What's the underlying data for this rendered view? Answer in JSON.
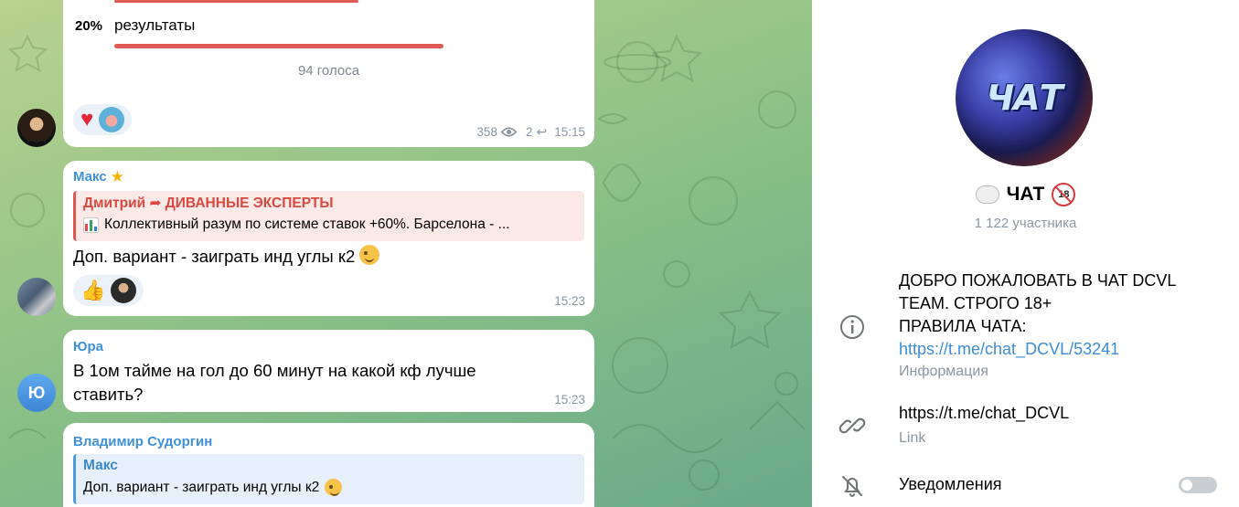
{
  "chat": {
    "poll": {
      "option_percent": "20%",
      "option_label": "результаты",
      "votes": "94 голоса",
      "views": "358",
      "replies": "2",
      "time": "15:15"
    },
    "messages": [
      {
        "sender": "Макс",
        "quote_title": "Дмитрий ➦ ДИВАННЫЕ ЭКСПЕРТЫ",
        "quote_text": "Коллективный разум по системе ставок +60%. Барселона - ...",
        "text": "Доп. вариант - заиграть инд углы к2",
        "time": "15:23"
      },
      {
        "sender": "Юра",
        "avatar_letter": "Ю",
        "text": "В 1ом тайме на гол до 60 минут на какой кф лучше ставить?",
        "time": "15:23"
      },
      {
        "sender": "Владимир Судоргин",
        "quote_title": "Макс",
        "quote_text": "Доп. вариант - заиграть инд углы к2"
      }
    ]
  },
  "info": {
    "avatar_text": "ЧАТ",
    "name": "ЧАТ",
    "members": "1 122 участника",
    "description_lines": [
      "ДОБРО ПОЖАЛОВАТЬ В ЧАТ DCVL",
      "TEAM. СТРОГО 18+",
      "ПРАВИЛА ЧАТА:"
    ],
    "description_link": "https://t.me/chat_DCVL/53241",
    "description_label": "Информация",
    "link": "https://t.me/chat_DCVL",
    "link_label": "Link",
    "notifications_label": "Уведомления",
    "notifications_on": false
  },
  "colors": {
    "accent": "#3d8cd5",
    "poll_bar": "#e05b54",
    "chat_bg": "#88bf86"
  }
}
